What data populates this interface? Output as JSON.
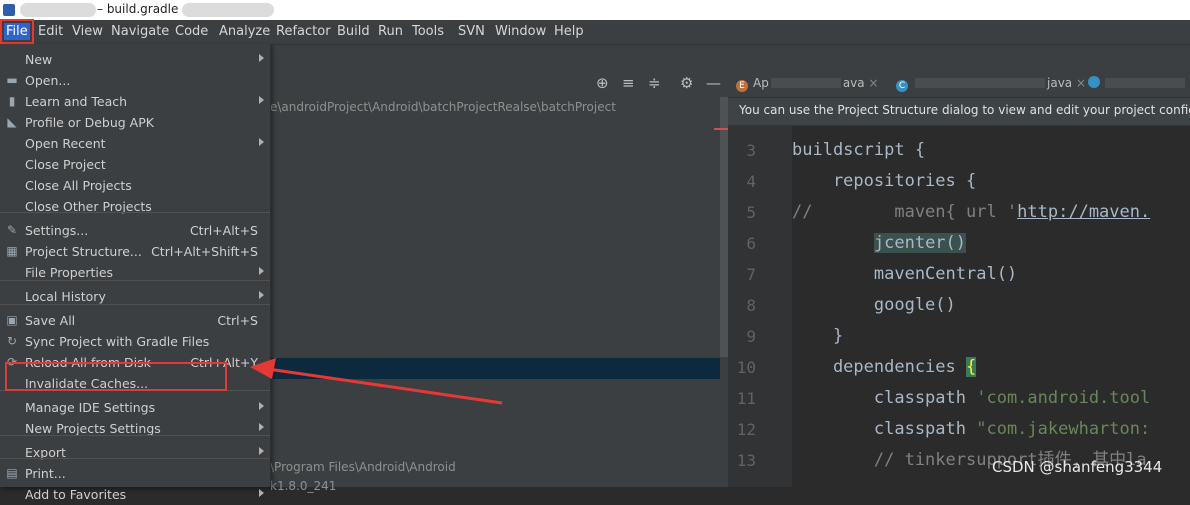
{
  "window": {
    "title": "– build.gradle"
  },
  "menubar": {
    "items": [
      "File",
      "Edit",
      "View",
      "Navigate",
      "Code",
      "Analyze",
      "Refactor",
      "Build",
      "Run",
      "Tools",
      "SVN",
      "Window",
      "Help"
    ]
  },
  "file_menu": {
    "items": [
      {
        "label": "New",
        "shortcut": "",
        "submenu": true,
        "icon": ""
      },
      {
        "label": "Open...",
        "shortcut": "",
        "submenu": false,
        "icon": "folder-icon"
      },
      {
        "label": "Learn and Teach",
        "shortcut": "",
        "submenu": true,
        "icon": "book-icon"
      },
      {
        "label": "Profile or Debug APK",
        "shortcut": "",
        "submenu": false,
        "icon": "profile-icon"
      },
      {
        "label": "Open Recent",
        "shortcut": "",
        "submenu": true,
        "icon": ""
      },
      {
        "label": "Close Project",
        "shortcut": "",
        "submenu": false,
        "icon": ""
      },
      {
        "label": "Close All Projects",
        "shortcut": "",
        "submenu": false,
        "icon": ""
      },
      {
        "label": "Close Other Projects",
        "shortcut": "",
        "submenu": false,
        "icon": ""
      },
      {
        "label": "Settings...",
        "shortcut": "Ctrl+Alt+S",
        "submenu": false,
        "icon": "wrench-icon"
      },
      {
        "label": "Project Structure...",
        "shortcut": "Ctrl+Alt+Shift+S",
        "submenu": false,
        "icon": "project-structure-icon"
      },
      {
        "label": "File Properties",
        "shortcut": "",
        "submenu": true,
        "icon": ""
      },
      {
        "label": "Local History",
        "shortcut": "",
        "submenu": true,
        "icon": ""
      },
      {
        "label": "Save All",
        "shortcut": "Ctrl+S",
        "submenu": false,
        "icon": "save-icon"
      },
      {
        "label": "Sync Project with Gradle Files",
        "shortcut": "",
        "submenu": false,
        "icon": "gradle-sync-icon"
      },
      {
        "label": "Reload All from Disk",
        "shortcut": "Ctrl+Alt+Y",
        "submenu": false,
        "icon": "reload-icon"
      },
      {
        "label": "Invalidate Caches...",
        "shortcut": "",
        "submenu": false,
        "icon": ""
      },
      {
        "label": "Manage IDE Settings",
        "shortcut": "",
        "submenu": true,
        "icon": ""
      },
      {
        "label": "New Projects Settings",
        "shortcut": "",
        "submenu": true,
        "icon": ""
      },
      {
        "label": "Export",
        "shortcut": "",
        "submenu": true,
        "icon": ""
      },
      {
        "label": "Print...",
        "shortcut": "",
        "submenu": false,
        "icon": "print-icon"
      },
      {
        "label": "Add to Favorites",
        "shortcut": "",
        "submenu": true,
        "icon": ""
      }
    ]
  },
  "project_panel": {
    "path": "e\\androidProject\\Android\\batchProjectRealse\\batchProject",
    "path2": "\\Program Files\\Android\\Android",
    "path3": "k1.8.0_241"
  },
  "editor": {
    "tabs": [
      {
        "label": "Ap",
        "suffix": "ava",
        "icon": "E",
        "color": "#c0703a"
      },
      {
        "label": "c",
        "suffix": "java",
        "icon": "C",
        "color": "#3592c4"
      },
      {
        "label": "",
        "suffix": "",
        "icon": "",
        "color": "#3592c4"
      }
    ],
    "banner": "You can use the Project Structure dialog to view and edit your project configu",
    "lines": [
      {
        "n": "3",
        "parts": [
          {
            "t": "buildscript {",
            "c": ""
          }
        ]
      },
      {
        "n": "4",
        "parts": [
          {
            "t": "    repositories {",
            "c": ""
          }
        ]
      },
      {
        "n": "5",
        "parts": [
          {
            "t": "//        maven{ url '",
            "c": "cm"
          },
          {
            "t": "http://maven.",
            "c": "url"
          }
        ]
      },
      {
        "n": "6",
        "parts": [
          {
            "t": "        ",
            "c": ""
          },
          {
            "t": "jcenter()",
            "c": "jc"
          }
        ]
      },
      {
        "n": "7",
        "parts": [
          {
            "t": "        mavenCentral()",
            "c": ""
          }
        ]
      },
      {
        "n": "8",
        "parts": [
          {
            "t": "        google()",
            "c": ""
          }
        ]
      },
      {
        "n": "9",
        "parts": [
          {
            "t": "    }",
            "c": ""
          }
        ]
      },
      {
        "n": "10",
        "parts": [
          {
            "t": "    dependencies ",
            "c": ""
          },
          {
            "t": "{",
            "c": "brace-hl"
          }
        ]
      },
      {
        "n": "11",
        "parts": [
          {
            "t": "        classpath ",
            "c": ""
          },
          {
            "t": "'com.android.tool",
            "c": "str"
          }
        ]
      },
      {
        "n": "12",
        "parts": [
          {
            "t": "        classpath ",
            "c": ""
          },
          {
            "t": "\"com.jakewharton:",
            "c": "str"
          }
        ]
      },
      {
        "n": "13",
        "parts": [
          {
            "t": "        // tinkersupport插件, 其中la",
            "c": "cm"
          }
        ]
      }
    ]
  },
  "watermark": "CSDN @shanfeng3344",
  "colors": {
    "highlight_red": "#e53935",
    "menu_bg": "#3c3f41",
    "selection": "#2f65ca"
  }
}
